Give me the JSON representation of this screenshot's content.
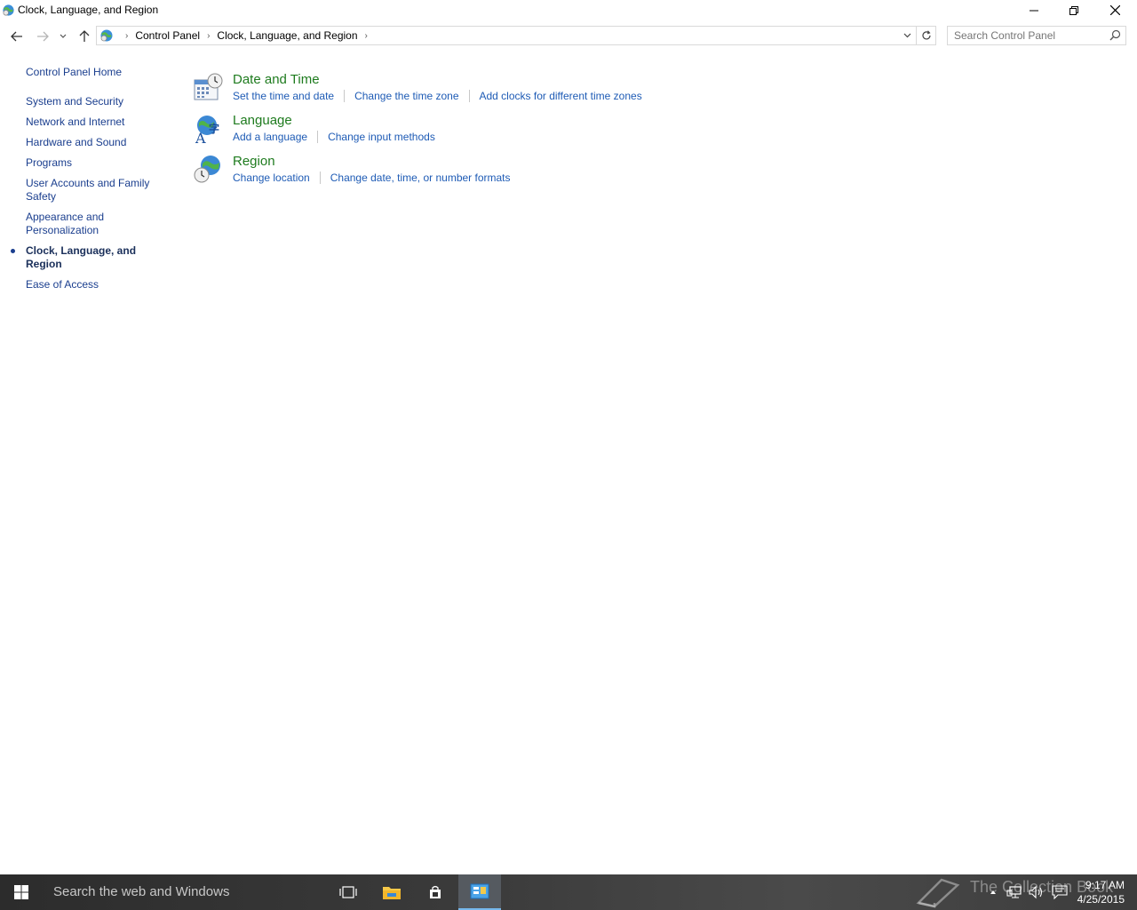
{
  "window": {
    "title": "Clock, Language, and Region"
  },
  "address": {
    "crumbs": [
      "Control Panel",
      "Clock, Language, and Region"
    ]
  },
  "search": {
    "placeholder": "Search Control Panel"
  },
  "leftnav": {
    "home": "Control Panel Home",
    "items": [
      {
        "label": "System and Security"
      },
      {
        "label": "Network and Internet"
      },
      {
        "label": "Hardware and Sound"
      },
      {
        "label": "Programs"
      },
      {
        "label": "User Accounts and Family Safety"
      },
      {
        "label": "Appearance and Personalization"
      },
      {
        "label": "Clock, Language, and Region",
        "active": true
      },
      {
        "label": "Ease of Access"
      }
    ]
  },
  "categories": [
    {
      "title": "Date and Time",
      "icon": "calendar-clock-icon",
      "links": [
        "Set the time and date",
        "Change the time zone",
        "Add clocks for different time zones"
      ]
    },
    {
      "title": "Language",
      "icon": "language-globe-icon",
      "links": [
        "Add a language",
        "Change input methods"
      ]
    },
    {
      "title": "Region",
      "icon": "region-globe-clock-icon",
      "links": [
        "Change location",
        "Change date, time, or number formats"
      ]
    }
  ],
  "taskbar": {
    "search_placeholder": "Search the web and Windows",
    "watermark": "The Collection Book",
    "time": "9:17 AM",
    "date": "4/25/2015"
  },
  "colors": {
    "link": "#1e5bb5",
    "category_title": "#1e7b1e",
    "nav_link": "#1a3e8e",
    "taskbar_accent": "#76b9ed"
  }
}
